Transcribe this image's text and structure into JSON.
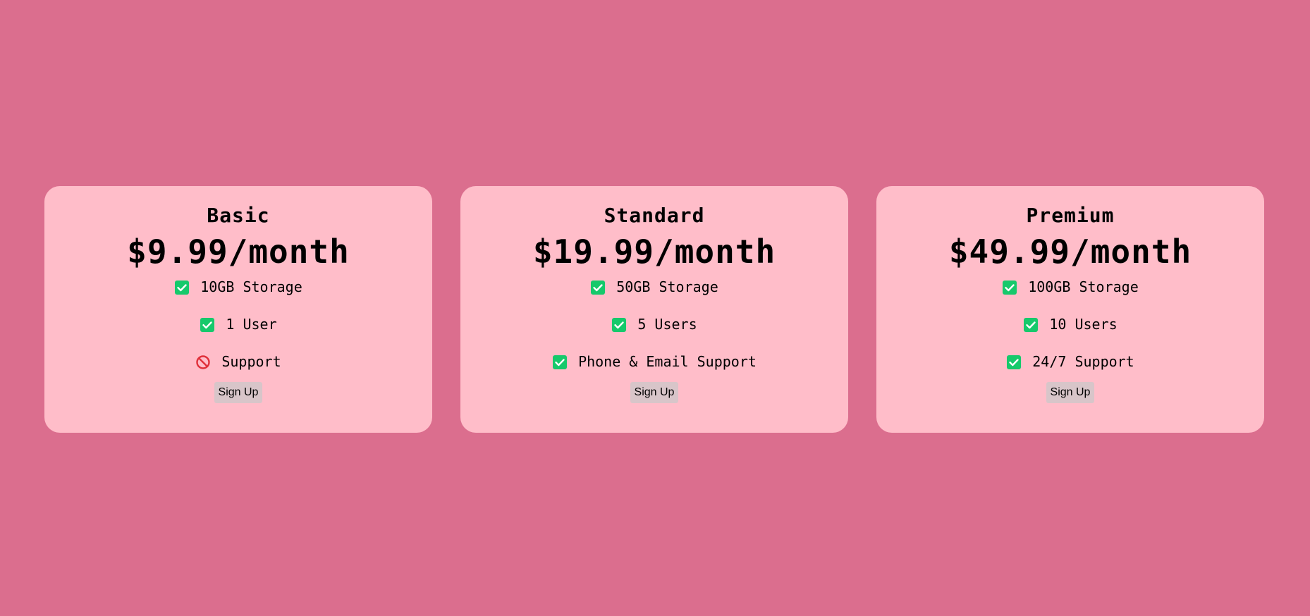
{
  "colors": {
    "page_background": "#db6e8e",
    "card_background": "#ffbdc9",
    "check_icon": "#16c96b",
    "no_icon": "#e0303a",
    "button_background": "#d8c5c9"
  },
  "plans": [
    {
      "name": "Basic",
      "price": "$9.99/month",
      "features": [
        {
          "icon": "check-icon",
          "text": "10GB Storage"
        },
        {
          "icon": "check-icon",
          "text": "1 User"
        },
        {
          "icon": "no-entry-icon",
          "text": "Support"
        }
      ],
      "button_label": "Sign Up"
    },
    {
      "name": "Standard",
      "price": "$19.99/month",
      "features": [
        {
          "icon": "check-icon",
          "text": "50GB Storage"
        },
        {
          "icon": "check-icon",
          "text": "5 Users"
        },
        {
          "icon": "check-icon",
          "text": "Phone & Email Support"
        }
      ],
      "button_label": "Sign Up"
    },
    {
      "name": "Premium",
      "price": "$49.99/month",
      "features": [
        {
          "icon": "check-icon",
          "text": "100GB Storage"
        },
        {
          "icon": "check-icon",
          "text": "10 Users"
        },
        {
          "icon": "check-icon",
          "text": "24/7 Support"
        }
      ],
      "button_label": "Sign Up"
    }
  ]
}
